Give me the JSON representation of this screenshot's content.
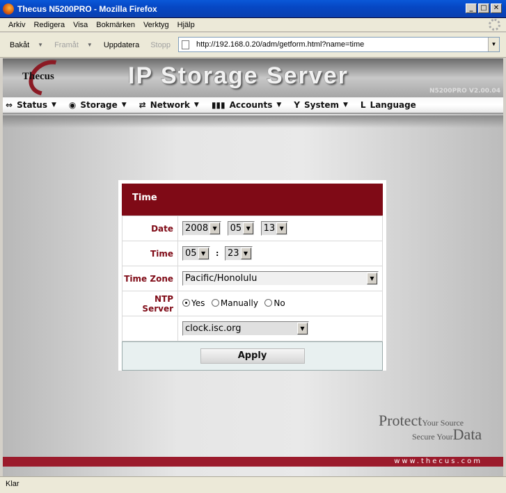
{
  "window": {
    "title": "Thecus N5200PRO - Mozilla Firefox"
  },
  "menubar": [
    "Arkiv",
    "Redigera",
    "Visa",
    "Bokmärken",
    "Verktyg",
    "Hjälp"
  ],
  "toolbar": {
    "back": "Bakåt",
    "forward": "Framåt",
    "reload": "Uppdatera",
    "stop": "Stopp"
  },
  "address": {
    "url": "http://192.168.0.20/adm/getform.html?name=time"
  },
  "header": {
    "logo": "Thecus",
    "title": "IP Storage Server",
    "version": "N5200PRO V2.00.04"
  },
  "nav": [
    {
      "label": "Status",
      "icon": "status-icon"
    },
    {
      "label": "Storage",
      "icon": "storage-icon"
    },
    {
      "label": "Network",
      "icon": "network-icon"
    },
    {
      "label": "Accounts",
      "icon": "accounts-icon"
    },
    {
      "label": "System",
      "icon": "system-icon"
    },
    {
      "label": "Language",
      "icon": "language-icon"
    }
  ],
  "panel": {
    "title": "Time",
    "date_label": "Date",
    "year": "2008",
    "month": "05",
    "day": "13",
    "time_label": "Time",
    "hour": "05",
    "time_sep": ":",
    "minute": "23",
    "tz_label": "Time Zone",
    "timezone": "Pacific/Honolulu",
    "ntp_label": "NTP Server",
    "ntp_yes": "Yes",
    "ntp_manually": "Manually",
    "ntp_no": "No",
    "ntp_server": "clock.isc.org",
    "apply": "Apply"
  },
  "brand": {
    "protect": "Protect",
    "your_source": "Your Source",
    "secure_your": "Secure Your",
    "data": "Data",
    "site": "www.thecus.com"
  },
  "status": {
    "text": "Klar"
  }
}
